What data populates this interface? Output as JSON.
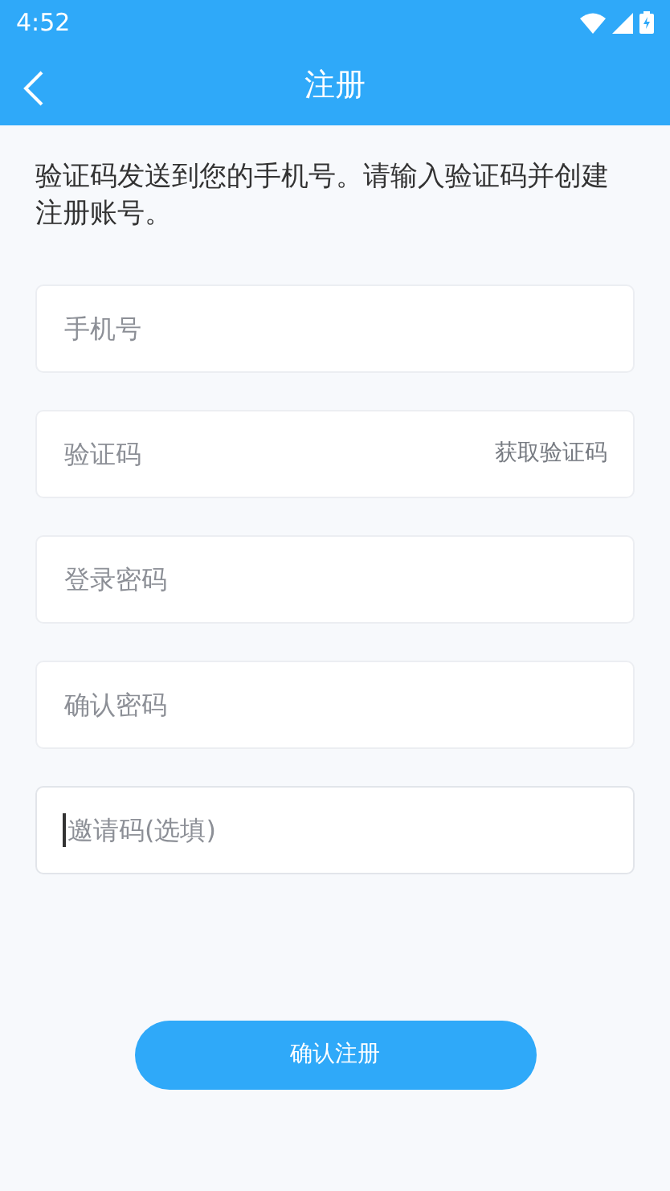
{
  "status_bar": {
    "time": "4:52"
  },
  "header": {
    "title": "注册"
  },
  "intro": "验证码发送到您的手机号。请输入验证码并创建注册账号。",
  "fields": [
    {
      "placeholder": "手机号",
      "focused": false
    },
    {
      "placeholder": "验证码",
      "focused": false,
      "action": "获取验证码"
    },
    {
      "placeholder": "登录密码",
      "focused": false
    },
    {
      "placeholder": "确认密码",
      "focused": false
    },
    {
      "placeholder": "邀请码(选填)",
      "focused": true
    }
  ],
  "submit": "确认注册"
}
